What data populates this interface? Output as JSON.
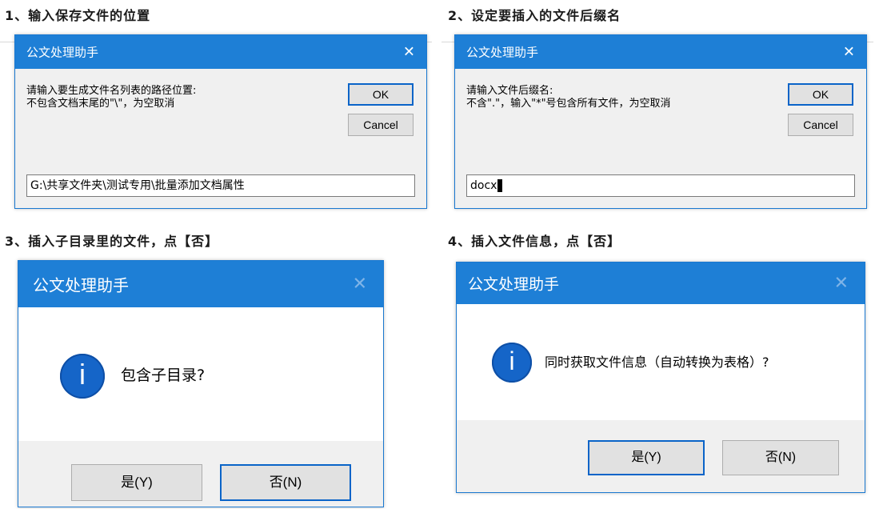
{
  "steps": [
    "1、输入保存文件的位置",
    "2、设定要插入的文件后缀名",
    "3、插入子目录里的文件，点【否】",
    "4、插入文件信息，点【否】"
  ],
  "dialogs": [
    {
      "title": "公文处理助手",
      "close_glyph": "✕",
      "prompt_line1": "请输入要生成文件名列表的路径位置:",
      "prompt_line2": "不包含文档末尾的\"\\\"，为空取消",
      "ok_label": "OK",
      "cancel_label": "Cancel",
      "input_value": "G:\\共享文件夹\\测试专用\\批量添加文档属性"
    },
    {
      "title": "公文处理助手",
      "close_glyph": "✕",
      "prompt_line1": "请输入文件后缀名:",
      "prompt_line2": "不含\".\"，输入\"*\"号包含所有文件，为空取消",
      "ok_label": "OK",
      "cancel_label": "Cancel",
      "input_value": "docx"
    },
    {
      "title": "公文处理助手",
      "close_glyph": "✕",
      "icon_glyph": "i",
      "message": "包含子目录?",
      "yes_label": "是(Y)",
      "no_label": "否(N)"
    },
    {
      "title": "公文处理助手",
      "close_glyph": "✕",
      "icon_glyph": "i",
      "message": "同时获取文件信息（自动转换为表格）?",
      "yes_label": "是(Y)",
      "no_label": "否(N)"
    }
  ],
  "colors": {
    "titlebar": "#1e7fd6",
    "focus_border": "#0a64c8",
    "info_icon": "#1565c8"
  }
}
